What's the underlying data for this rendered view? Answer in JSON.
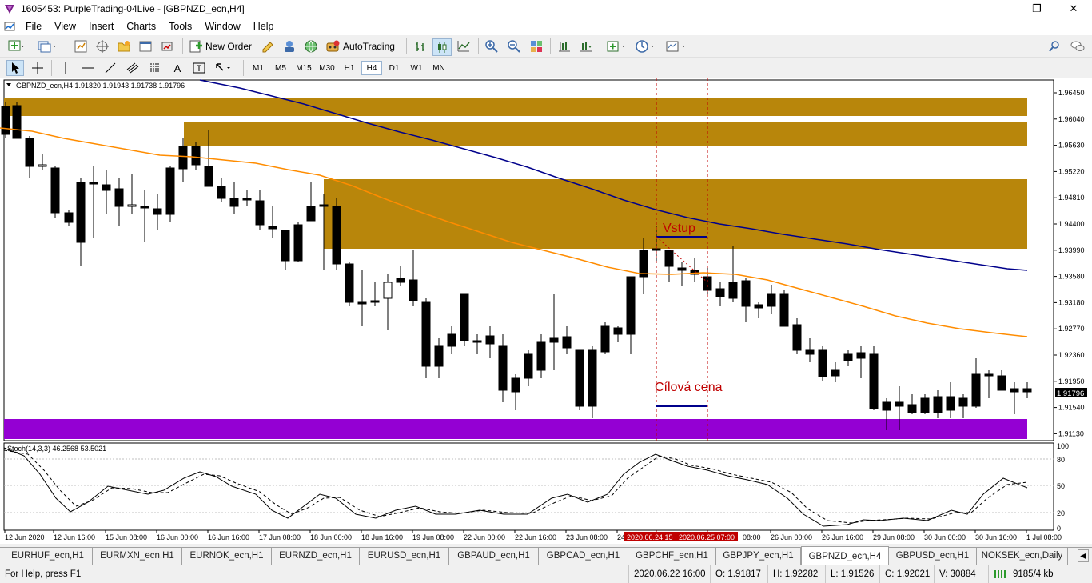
{
  "title": "1605453: PurpleTrading-04Live - [GBPNZD_ecn,H4]",
  "menu": [
    "File",
    "View",
    "Insert",
    "Charts",
    "Tools",
    "Window",
    "Help"
  ],
  "toolbar": {
    "new_order": "New Order",
    "autotrading": "AutoTrading"
  },
  "timeframes": [
    "M1",
    "M5",
    "M15",
    "M30",
    "H1",
    "H4",
    "D1",
    "W1",
    "MN"
  ],
  "active_timeframe": "H4",
  "chart": {
    "info": "GBPNZD_ecn,H4  1.91820 1.91943 1.91738 1.91796",
    "price_labels": [
      "1.96450",
      "1.96040",
      "1.95630",
      "1.95220",
      "1.94810",
      "1.94400",
      "1.93990",
      "1.93580",
      "1.93180",
      "1.92770",
      "1.92360",
      "1.91950",
      "1.91540",
      "1.91130"
    ],
    "current_price": "1.91796",
    "annotation_entry": "Vstup",
    "annotation_target": "Cílová cena",
    "stoch_info": "Stoch(14,3,3) 46.2568 53.5021",
    "stoch_levels": [
      "100",
      "80",
      "50",
      "20",
      "0"
    ],
    "time_labels": [
      "12 Jun 2020",
      "12 Jun 16:00",
      "15 Jun 08:00",
      "16 Jun 00:00",
      "16 Jun 16:00",
      "17 Jun 08:00",
      "18 Jun 00:00",
      "18 Jun 16:00",
      "19 Jun 08:00",
      "22 Jun 00:00",
      "22 Jun 16:00",
      "23 Jun 08:00",
      "24",
      "26 Jun 00:00",
      "26 Jun 16:00",
      "29 Jun 08:00",
      "30 Jun 00:00",
      "30 Jun 16:00",
      "1 Jul 08:00"
    ],
    "crosshair_time_1": "2020.06.24 15",
    "crosshair_time_2": "2020.06.25 07:00",
    "after_label": "08:00",
    "colors": {
      "zone": "#b8860b",
      "zone_purple": "#9400d3",
      "ma_fast": "#ff8c00",
      "ma_slow": "#00008b",
      "annotation": "#c00000"
    }
  },
  "tabs": [
    "EURHUF_ecn,H1",
    "EURMXN_ecn,H1",
    "EURNOK_ecn,H1",
    "EURNZD_ecn,H1",
    "EURUSD_ecn,H1",
    "GBPAUD_ecn,H1",
    "GBPCAD_ecn,H1",
    "GBPCHF_ecn,H1",
    "GBPJPY_ecn,H1",
    "GBPNZD_ecn,H4",
    "GBPUSD_ecn,H1",
    "NOKSEK_ecn,Daily"
  ],
  "active_tab": "GBPNZD_ecn,H4",
  "status": {
    "help": "For Help, press F1",
    "time": "2020.06.22 16:00",
    "open": "O: 1.91817",
    "high": "H: 1.92282",
    "low": "L: 1.91526",
    "close": "C: 1.92021",
    "volume": "V: 30884",
    "traffic": "9185/4 kb"
  }
}
